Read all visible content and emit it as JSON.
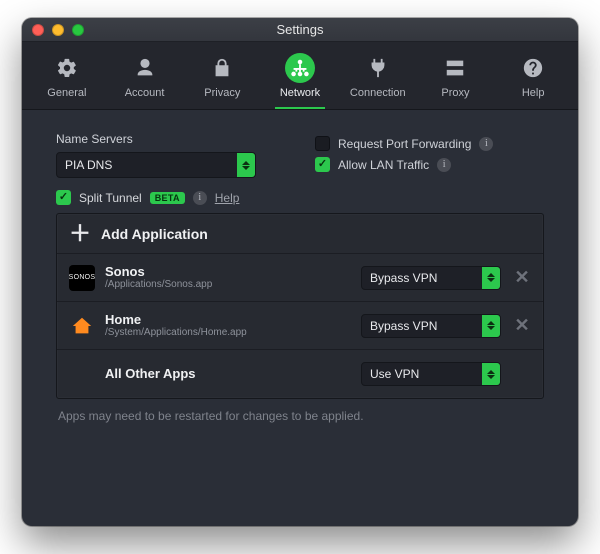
{
  "window": {
    "title": "Settings"
  },
  "tabs": {
    "items": [
      {
        "label": "General"
      },
      {
        "label": "Account"
      },
      {
        "label": "Privacy"
      },
      {
        "label": "Network"
      },
      {
        "label": "Connection"
      },
      {
        "label": "Proxy"
      },
      {
        "label": "Help"
      }
    ],
    "active_index": 3
  },
  "name_servers": {
    "label": "Name Servers",
    "value": "PIA DNS"
  },
  "options": {
    "port_forwarding": {
      "label": "Request Port Forwarding",
      "checked": false
    },
    "lan_traffic": {
      "label": "Allow LAN Traffic",
      "checked": true
    }
  },
  "split_tunnel": {
    "checked": true,
    "label": "Split Tunnel",
    "badge": "BETA",
    "help": "Help",
    "add_label": "Add Application",
    "rows": [
      {
        "name": "Sonos",
        "path": "/Applications/Sonos.app",
        "mode": "Bypass VPN",
        "icon": "sonos",
        "removable": true
      },
      {
        "name": "Home",
        "path": "/System/Applications/Home.app",
        "mode": "Bypass VPN",
        "icon": "home",
        "removable": true
      },
      {
        "name": "All Other Apps",
        "path": "",
        "mode": "Use VPN",
        "icon": "",
        "removable": false
      }
    ]
  },
  "footer": "Apps may need to be restarted for changes to be applied."
}
